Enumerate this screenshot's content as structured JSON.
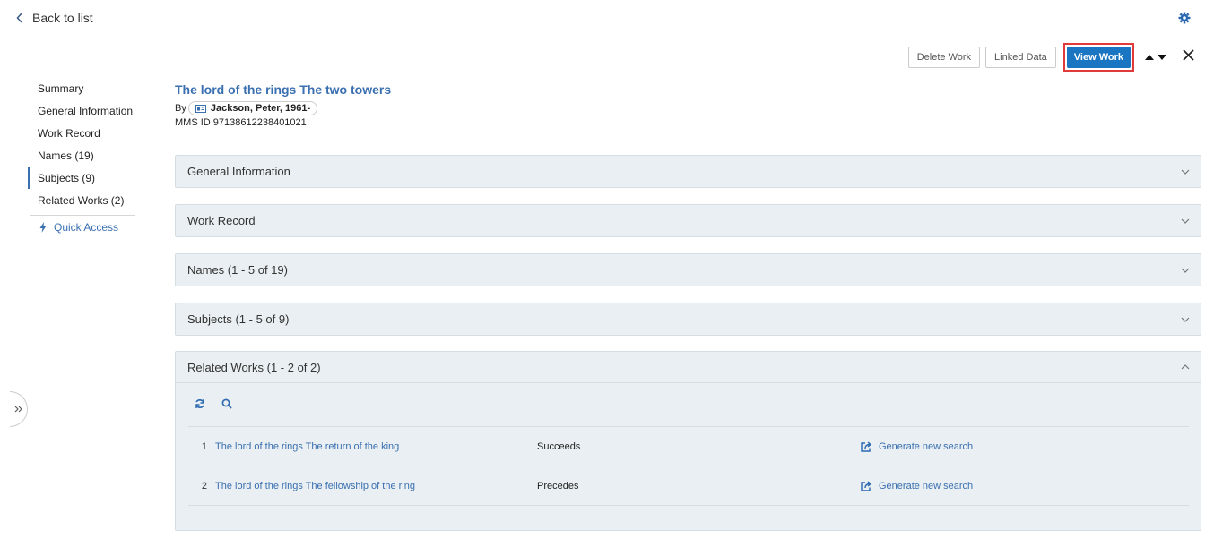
{
  "topbar": {
    "back_label": "Back to list"
  },
  "actions": {
    "delete_label": "Delete Work",
    "linked_label": "Linked Data",
    "view_label": "View Work"
  },
  "sidenav": {
    "items": [
      {
        "label": "Summary"
      },
      {
        "label": "General Information"
      },
      {
        "label": "Work Record"
      },
      {
        "label": "Names (19)"
      },
      {
        "label": "Subjects (9)"
      },
      {
        "label": "Related Works (2)"
      }
    ],
    "quick_access": "Quick Access"
  },
  "record": {
    "title": "The lord of the rings The two towers",
    "by_label": "By",
    "author": "Jackson, Peter, 1961-",
    "mms": "MMS ID 97138612238401021"
  },
  "sections": [
    {
      "label": "General Information"
    },
    {
      "label": "Work Record"
    },
    {
      "label": "Names (1 - 5 of 19)"
    },
    {
      "label": "Subjects (1 - 5 of 9)"
    },
    {
      "label": "Related Works (1 - 2 of 2)"
    }
  ],
  "related": [
    {
      "num": "1",
      "title": "The lord of the rings The return of the king",
      "relation": "Succeeds",
      "action": "Generate new search"
    },
    {
      "num": "2",
      "title": "The lord of the rings The fellowship of the ring",
      "relation": "Precedes",
      "action": "Generate new search"
    }
  ],
  "colors": {
    "accent": "#1a76c2",
    "link": "#3a6fb0",
    "panel_bg": "#e9eff2",
    "highlight": "#e03a3a"
  }
}
